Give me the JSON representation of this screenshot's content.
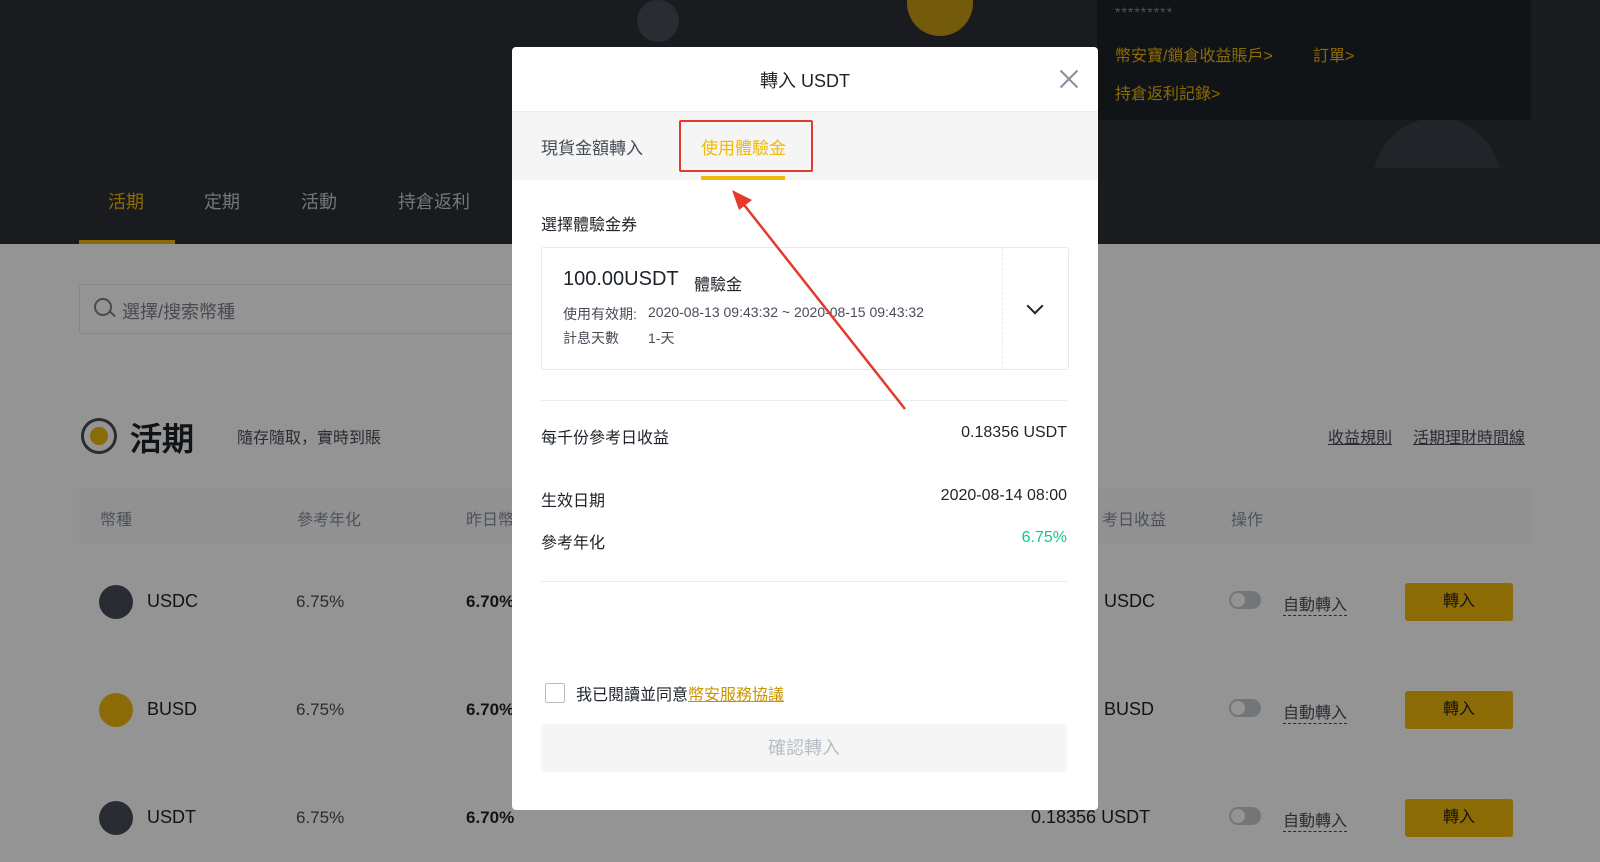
{
  "account": {
    "masked": "*********",
    "savings_link": "幣安寶/鎖倉收益賬戶>",
    "orders_link": "訂單>",
    "rebate_record_link": "持倉返利記錄>"
  },
  "nav": {
    "tabs": [
      "活期",
      "定期",
      "活動",
      "持倉返利"
    ],
    "active_index": 0
  },
  "search": {
    "placeholder": "選擇/搜索幣種"
  },
  "section": {
    "title": "活期",
    "subtitle": "隨存隨取，實時到賬",
    "links": [
      "收益規則",
      "活期理財時間線"
    ]
  },
  "table": {
    "headers": [
      "幣種",
      "參考年化",
      "昨日幣",
      "考日收益",
      "操作"
    ],
    "rows": [
      {
        "coin": "USDC",
        "ref_apy": "6.75%",
        "yesterday": "6.70%",
        "right": "USDC",
        "auto_label": "自動轉入",
        "button": "轉入",
        "icon": "usdc-icon"
      },
      {
        "coin": "BUSD",
        "ref_apy": "6.75%",
        "yesterday": "6.70%",
        "right": "BUSD",
        "auto_label": "自動轉入",
        "button": "轉入",
        "icon": "busd-icon"
      },
      {
        "coin": "USDT",
        "ref_apy": "6.75%",
        "yesterday": "6.70%",
        "right": "0.18356 USDT",
        "auto_label": "自動轉入",
        "button": "轉入",
        "icon": "usdt-icon"
      }
    ]
  },
  "modal": {
    "title": "轉入 USDT",
    "tabs": [
      "現貨金額轉入",
      "使用體驗金"
    ],
    "active_tab": 1,
    "voucher_label": "選擇體驗金券",
    "voucher": {
      "amount": "100.00USDT",
      "type": "體驗金",
      "validity_label": "使用有效期:",
      "validity": "2020-08-13 09:43:32 ~ 2020-08-15 09:43:32",
      "days_label": "計息天數",
      "days": "1-天"
    },
    "daily_yield_label": "每千份參考日收益",
    "daily_yield": "0.18356 USDT",
    "effective_date_label": "生效日期",
    "effective_date": "2020-08-14 08:00",
    "ref_apy_label": "參考年化",
    "ref_apy": "6.75%",
    "agree_text": "我已閱讀並同意",
    "agree_link": "幣安服務協議",
    "confirm_button": "確認轉入"
  },
  "colors": {
    "accent": "#f0b90b",
    "positive": "#0ecb81",
    "annotation": "#e4392b",
    "dark_bg": "#2b2f36"
  }
}
